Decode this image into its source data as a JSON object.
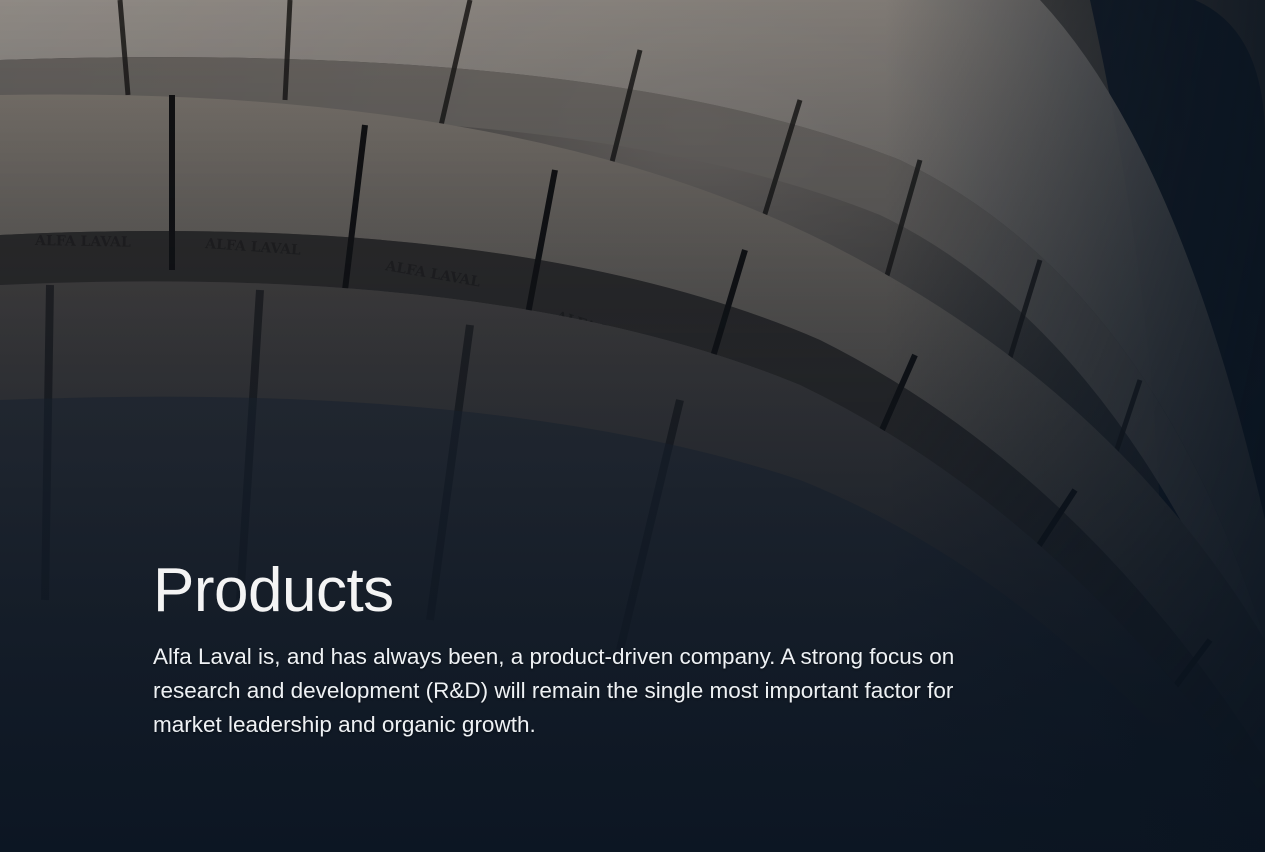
{
  "hero": {
    "title": "Products",
    "body": "Alfa Laval is, and has always been, a product-driven company. A strong focus on research and development (R&D) will remain the single most important factor for market leadership and organic growth.",
    "photo_subject": "curved ring of metal segments stamped ALFA LAVAL",
    "engraving_text": "ALFA LAVAL"
  },
  "colors": {
    "background": "#0c1724",
    "text": "#ffffff"
  }
}
